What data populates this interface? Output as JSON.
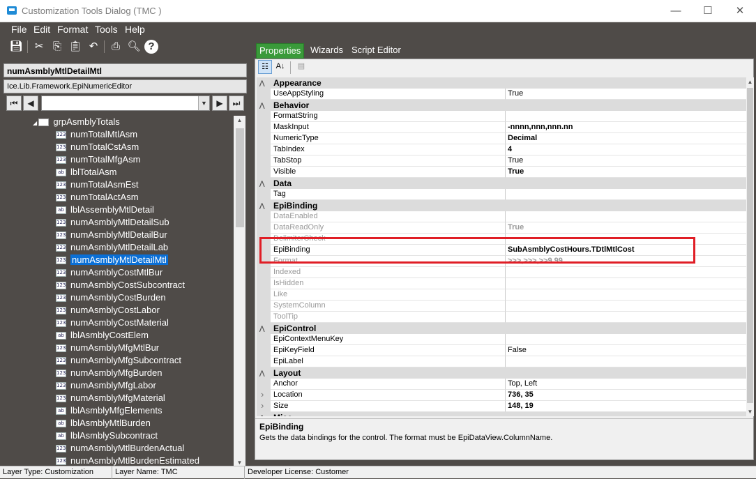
{
  "window": {
    "title": "Customization Tools Dialog  (TMC )",
    "minimize": "—",
    "maximize": "☐",
    "close": "✕"
  },
  "menu": [
    "File",
    "Edit",
    "Format",
    "Tools",
    "Help"
  ],
  "toolbar_icons": [
    "save-icon",
    "cut-icon",
    "copy-icon",
    "paste-icon",
    "undo-icon",
    "print-icon",
    "print-preview-icon",
    "help-icon"
  ],
  "control": {
    "name": "numAsmblyMtlDetailMtl",
    "type": "Ice.Lib.Framework.EpiNumericEditor"
  },
  "nav": {
    "first": "⏮",
    "prev": "◀",
    "next": "▶",
    "last": "⏭",
    "combo_value": ""
  },
  "tree": {
    "group": "grpAsmblyTotals",
    "items": [
      {
        "label": "numTotalMtlAsm",
        "icon": "123"
      },
      {
        "label": "numTotalCstAsm",
        "icon": "123"
      },
      {
        "label": "numTotalMfgAsm",
        "icon": "123"
      },
      {
        "label": "lblTotalAsm",
        "icon": "ab"
      },
      {
        "label": "numTotalAsmEst",
        "icon": "123"
      },
      {
        "label": "numTotalActAsm",
        "icon": "123"
      },
      {
        "label": "lblAssemblyMtlDetail",
        "icon": "ab"
      },
      {
        "label": "numAsmblyMtlDetailSub",
        "icon": "123"
      },
      {
        "label": "numAsmblyMtlDetailBur",
        "icon": "123"
      },
      {
        "label": "numAsmblyMtlDetailLab",
        "icon": "123"
      },
      {
        "label": "numAsmblyMtlDetailMtl",
        "icon": "123",
        "selected": true
      },
      {
        "label": "numAsmblyCostMtlBur",
        "icon": "123"
      },
      {
        "label": "numAsmblyCostSubcontract",
        "icon": "123"
      },
      {
        "label": "numAsmblyCostBurden",
        "icon": "123"
      },
      {
        "label": "numAsmblyCostLabor",
        "icon": "123"
      },
      {
        "label": "numAsmblyCostMaterial",
        "icon": "123"
      },
      {
        "label": "lblAsmblyCostElem",
        "icon": "ab"
      },
      {
        "label": "numAsmblyMfgMtlBur",
        "icon": "123"
      },
      {
        "label": "numAsmblyMfgSubcontract",
        "icon": "123"
      },
      {
        "label": "numAsmblyMfgBurden",
        "icon": "123"
      },
      {
        "label": "numAsmblyMfgLabor",
        "icon": "123"
      },
      {
        "label": "numAsmblyMfgMaterial",
        "icon": "123"
      },
      {
        "label": "lblAsmblyMfgElements",
        "icon": "ab"
      },
      {
        "label": "lblAsmblyMtlBurden",
        "icon": "ab"
      },
      {
        "label": "lblAsmblySubcontract",
        "icon": "ab"
      },
      {
        "label": "numAsmblyMtlBurdenActual",
        "icon": "123"
      },
      {
        "label": "numAsmblyMtlBurdenEstimated",
        "icon": "123"
      }
    ]
  },
  "tabs": [
    "Properties",
    "Wizards",
    "Script Editor"
  ],
  "grid": [
    {
      "cat": "Appearance",
      "rows": [
        {
          "n": "UseAppStyling",
          "v": "True"
        }
      ]
    },
    {
      "cat": "Behavior",
      "rows": [
        {
          "n": "FormatString",
          "v": ""
        },
        {
          "n": "MaskInput",
          "v": "-nnnn,nnn,nnn.nn",
          "b": true
        },
        {
          "n": "NumericType",
          "v": "Decimal",
          "b": true
        },
        {
          "n": "TabIndex",
          "v": "4",
          "b": true
        },
        {
          "n": "TabStop",
          "v": "True"
        },
        {
          "n": "Visible",
          "v": "True",
          "b": true
        }
      ]
    },
    {
      "cat": "Data",
      "rows": [
        {
          "n": "Tag",
          "v": ""
        }
      ]
    },
    {
      "cat": "EpiBinding",
      "rows": [
        {
          "n": "DataEnabled",
          "v": "",
          "d": true
        },
        {
          "n": "DataReadOnly",
          "v": "True",
          "d": true,
          "b": true
        },
        {
          "n": "DelimiterCheck",
          "v": "",
          "d": true
        },
        {
          "n": "EpiBinding",
          "v": "SubAsmblyCostHours.TDtlMtlCost",
          "b": true
        },
        {
          "n": "Format",
          "v": ">>>,>>>,>>9.99",
          "d": true,
          "b": true
        },
        {
          "n": "Indexed",
          "v": "",
          "d": true
        },
        {
          "n": "IsHidden",
          "v": "",
          "d": true
        },
        {
          "n": "Like",
          "v": "",
          "d": true
        },
        {
          "n": "SystemColumn",
          "v": "",
          "d": true
        },
        {
          "n": "ToolTip",
          "v": "",
          "d": true
        }
      ]
    },
    {
      "cat": "EpiControl",
      "rows": [
        {
          "n": "EpiContextMenuKey",
          "v": ""
        },
        {
          "n": "EpiKeyField",
          "v": "False"
        },
        {
          "n": "EpiLabel",
          "v": ""
        }
      ]
    },
    {
      "cat": "Layout",
      "rows": [
        {
          "n": "Anchor",
          "v": "Top, Left"
        },
        {
          "n": "Location",
          "v": "736, 35",
          "b": true,
          "exp": true
        },
        {
          "n": "Size",
          "v": "148, 19",
          "b": true,
          "exp": true
        }
      ]
    },
    {
      "cat": "Misc",
      "rows": []
    }
  ],
  "description": {
    "title": "EpiBinding",
    "text": "Gets the data bindings for the control. The format must be EpiDataView.ColumnName."
  },
  "status": {
    "layer_type": "Layer Type:  Customization",
    "layer_name": "Layer Name:  TMC",
    "license": "Developer License:  Customer"
  },
  "colors": {
    "highlight": "#e01e26",
    "selection": "#0a6fd6",
    "tab_active": "#3a9a3a",
    "background": "#4f4b48"
  }
}
